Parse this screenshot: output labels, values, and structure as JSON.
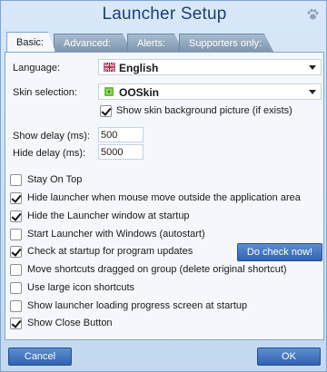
{
  "window": {
    "title": "Launcher Setup",
    "corner_icon": "paw-icon"
  },
  "tabs": [
    {
      "label": "Basic:",
      "active": true
    },
    {
      "label": "Advanced:"
    },
    {
      "label": "Alerts:"
    },
    {
      "label": "Supporters only:"
    }
  ],
  "basic": {
    "language_label": "Language:",
    "language_value": "English",
    "skin_label": "Skin selection:",
    "skin_value": "OOSkin",
    "show_bg_label": "Show skin background picture (if exists)",
    "show_delay_label": "Show delay (ms):",
    "show_delay_value": "500",
    "hide_delay_label": "Hide delay (ms):",
    "hide_delay_value": "5000",
    "options": [
      {
        "label": "Stay On Top",
        "checked": false
      },
      {
        "label": "Hide launcher when mouse move outside the application area",
        "checked": true
      },
      {
        "label": "Hide the Launcher window at startup",
        "checked": true
      },
      {
        "label": "Start Launcher with Windows (autostart)",
        "checked": false
      },
      {
        "label": "Check at startup for program updates",
        "checked": true
      },
      {
        "label": "Move shortcuts dragged on group (delete original shortcut)",
        "checked": false
      },
      {
        "label": "Use large icon shortcuts",
        "checked": false
      },
      {
        "label": "Show launcher loading progress screen at startup",
        "checked": false
      },
      {
        "label": "Show Close Button",
        "checked": true
      }
    ],
    "check_now_label": "Do check now!"
  },
  "footer": {
    "cancel_label": "Cancel",
    "ok_label": "OK"
  },
  "colors": {
    "accent": "#2f63b2",
    "title": "#1e3f6e",
    "panel": "#f4f7fb"
  }
}
